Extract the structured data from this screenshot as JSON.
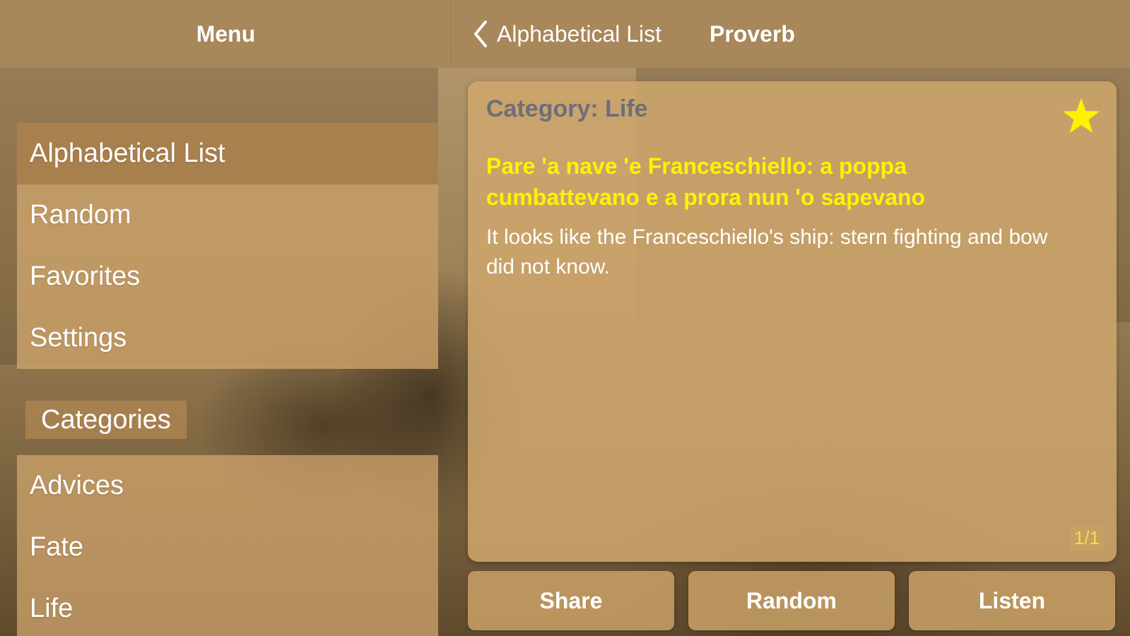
{
  "left_header": {
    "title": "Menu"
  },
  "right_header": {
    "back_label": "Alphabetical List",
    "title": "Proverb"
  },
  "menu": {
    "main_items": [
      {
        "label": "Alphabetical List"
      },
      {
        "label": "Random"
      },
      {
        "label": "Favorites"
      },
      {
        "label": "Settings"
      }
    ],
    "section_label": "Categories",
    "category_items": [
      {
        "label": "Advices"
      },
      {
        "label": "Fate"
      },
      {
        "label": "Life"
      }
    ]
  },
  "card": {
    "category": "Category: Life",
    "proverb": "Pare 'a nave 'e Franceschiello: a poppa cumbattevano e a prora nun 'o sapevano",
    "translation": "It looks like the Franceschiello's ship: stern fighting and bow did not know.",
    "pager": "1/1",
    "favorite_icon": "star-icon"
  },
  "actions": {
    "share": "Share",
    "random": "Random",
    "listen": "Listen"
  },
  "colors": {
    "bar": "#a8875a",
    "proverb_text": "#fff200",
    "category_text": "#6c6f7a",
    "star": "#fff200"
  }
}
